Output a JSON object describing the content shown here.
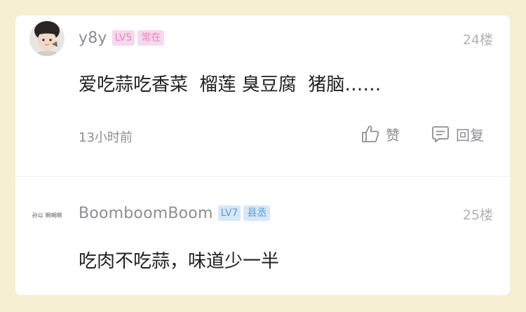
{
  "comments": [
    {
      "username": "y8y",
      "level": "LV5",
      "title": "常在",
      "floor": "24楼",
      "content": "爱吃蒜吃香菜  榴莲 臭豆腐  猪脑……",
      "time": "13小时前",
      "actions": {
        "like_label": "赞",
        "reply_label": "回复"
      }
    },
    {
      "username": "BoomboomBoom",
      "level": "LV7",
      "title": "县丞",
      "floor": "25楼",
      "content": "吃肉不吃蒜，味道少一半",
      "avatar_text": "孙以 啊啊啊"
    }
  ],
  "icons": {
    "like": "thumbs-up-icon",
    "reply": "comment-bubble-icon"
  },
  "colors": {
    "background": "#f7efd2",
    "card": "#ffffff",
    "pink_badge_bg": "#f5d9ec",
    "pink_badge_text": "#f082c8",
    "blue_badge_bg": "#d6e8f8",
    "blue_badge_text": "#5b9ad7"
  }
}
